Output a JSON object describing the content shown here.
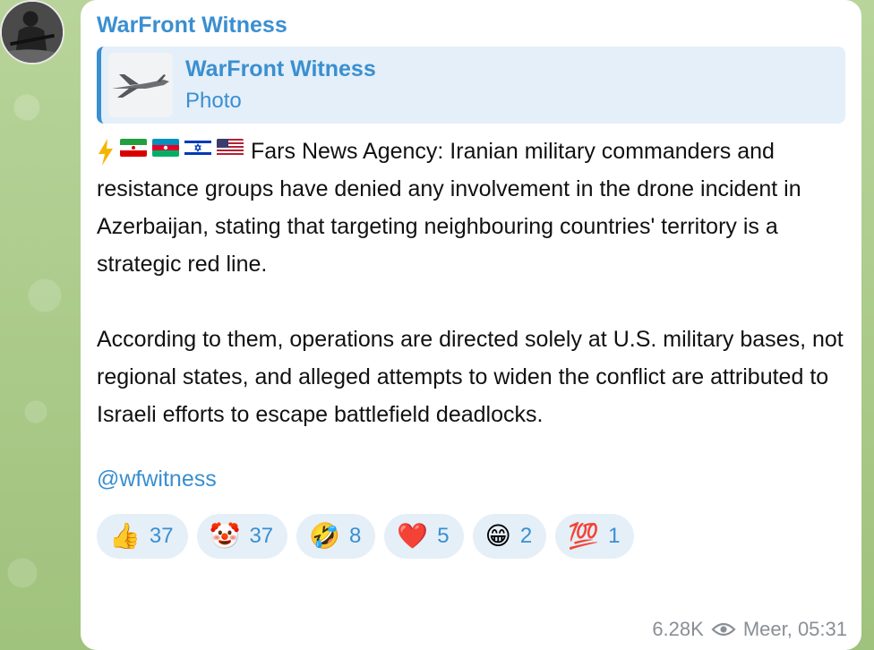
{
  "channel": {
    "sender_name": "WarFront Witness",
    "avatar_icon": "soldier-avatar-icon"
  },
  "reply": {
    "title": "WarFront Witness",
    "subtitle": "Photo",
    "thumb_icon": "drone-thumbnail"
  },
  "message": {
    "paragraph1": "Fars News Agency: Iranian military commanders and resistance groups have denied any involvement in the drone incident in Azerbaijan, stating that targeting neighbouring countries' territory is a strategic red line.",
    "paragraph2": "According to them, operations are directed solely at U.S. military bases, not regional states, and alleged attempts to widen the conflict are attributed to Israeli efforts to escape battlefield deadlocks.",
    "handle": "@wfwitness",
    "prefix_icons": [
      "lightning-icon",
      "iran-flag",
      "azerbaijan-flag",
      "israel-flag",
      "us-flag"
    ]
  },
  "reactions": [
    {
      "emoji": "👍",
      "count": "37"
    },
    {
      "emoji": "🤡",
      "count": "37"
    },
    {
      "emoji": "🤣",
      "count": "8"
    },
    {
      "emoji": "❤️",
      "count": "5"
    },
    {
      "emoji": "😁",
      "count": "2"
    },
    {
      "emoji": "💯",
      "count": "1"
    }
  ],
  "meta": {
    "views": "6.28K",
    "time": "Meer, 05:31"
  },
  "colors": {
    "accent": "#3a8fd0",
    "reply_bg": "#e4eff9",
    "chip_bg": "#e5eff8"
  }
}
